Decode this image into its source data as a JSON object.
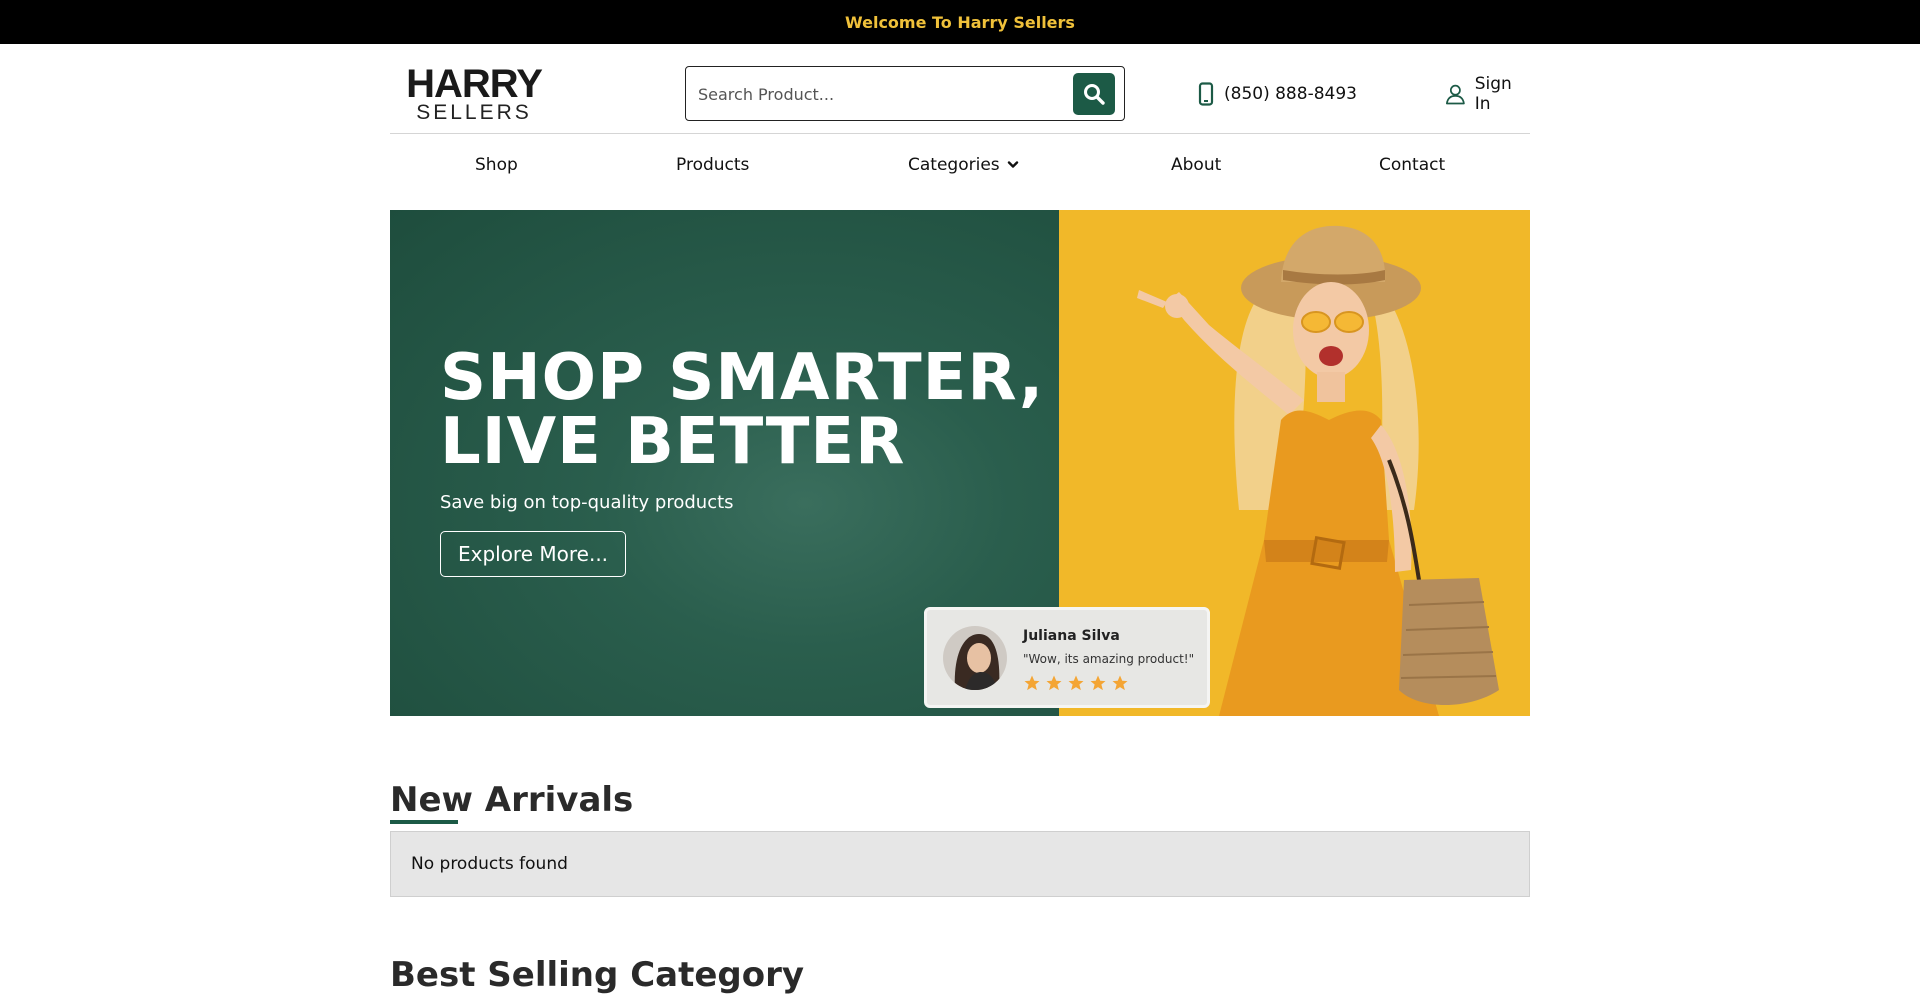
{
  "topbar": {
    "welcome": "Welcome To Harry Sellers"
  },
  "header": {
    "logo_line1": "HARRY",
    "logo_line2": "SELLERS",
    "search_placeholder": "Search Product...",
    "phone": "(850) 888-8493",
    "signin": "Sign In",
    "icons": {
      "search": "search-icon",
      "phone": "phone-icon",
      "user": "user-icon"
    }
  },
  "nav": {
    "items": [
      "Shop",
      "Products",
      "Categories",
      "About",
      "Contact"
    ]
  },
  "hero": {
    "title_line1": "SHOP SMARTER,",
    "title_line2": "LIVE BETTER",
    "subtitle": "Save big on top-quality products",
    "cta": "Explore More...",
    "review": {
      "name": "Juliana Silva",
      "quote": "\"Wow, its amazing product!\"",
      "rating": 5
    }
  },
  "new_arrivals": {
    "title_word1": "New",
    "title_word2": "Arrivals",
    "empty_message": "No products found"
  },
  "best_selling": {
    "title": "Best Selling Category"
  },
  "colors": {
    "brand_green": "#1c5a46",
    "accent_yellow": "#f0c13a",
    "hero_yellow": "#f1b829",
    "star_orange": "#f4a534"
  }
}
